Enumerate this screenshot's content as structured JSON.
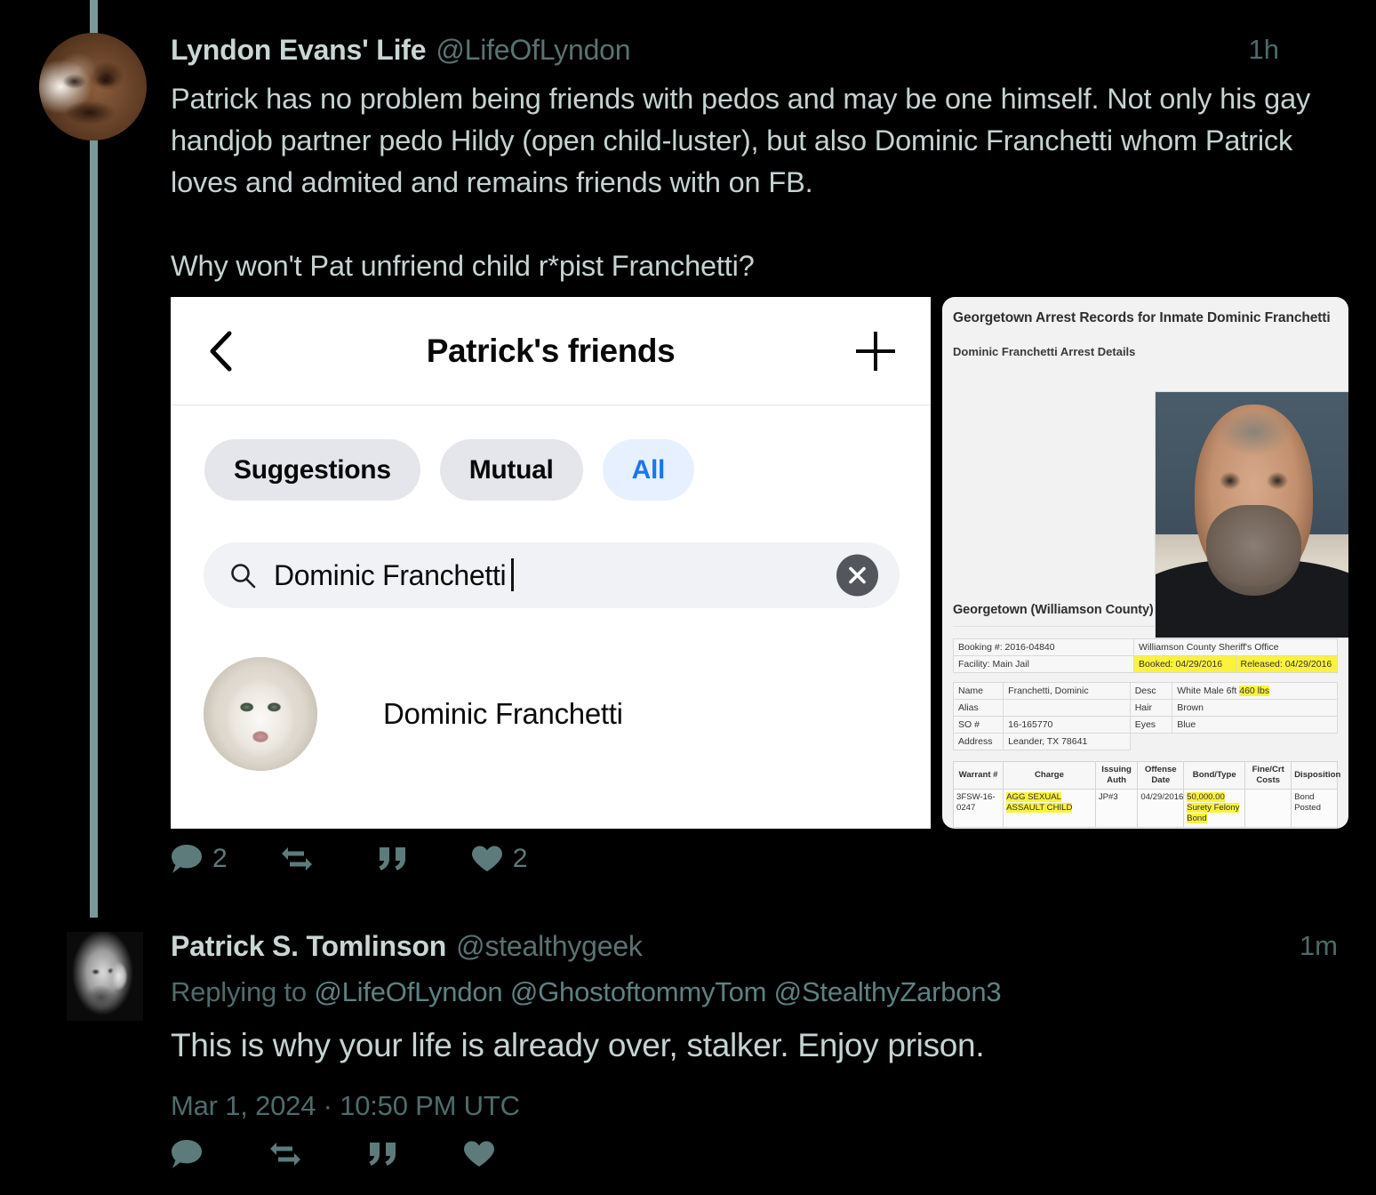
{
  "thread": {
    "tweets": [
      {
        "display_name": "Lyndon Evans' Life",
        "handle": "@LifeOfLyndon",
        "timestamp": "1h",
        "body_line1": "Patrick has no problem being friends with pedos and may be one himself. Not only his gay handjob partner pedo Hildy (open child-luster), but also Dominic Franchetti whom Patrick loves and admited and remains friends with on FB.",
        "body_line2": "Why won't Pat unfriend child r*pist Franchetti?",
        "actions": {
          "reply_count": "2",
          "retweet_count": "",
          "quote_count": "",
          "like_count": "2"
        }
      },
      {
        "display_name": "Patrick S. Tomlinson",
        "handle": "@stealthygeek",
        "timestamp": "1m",
        "replying_to_label": "Replying to",
        "replying_to_mentions": "@LifeOfLyndon @GhostoftommyTom @StealthyZarbon3",
        "body": "This is why your life is already over, stalker. Enjoy prison.",
        "date": "Mar 1, 2024 · 10:50 PM UTC",
        "actions": {
          "reply_count": "",
          "retweet_count": "",
          "quote_count": "",
          "like_count": ""
        }
      }
    ]
  },
  "facebook_card": {
    "title": "Patrick's friends",
    "back_icon": "chevron-left-icon",
    "add_icon": "plus-icon",
    "chips": [
      {
        "label": "Suggestions",
        "active": false
      },
      {
        "label": "Mutual",
        "active": false
      },
      {
        "label": "All",
        "active": true
      }
    ],
    "search": {
      "icon": "search-icon",
      "value": "Dominic Franchetti",
      "clear_icon": "close-circle-icon"
    },
    "results": [
      {
        "name": "Dominic Franchetti",
        "avatar": "white-lion-avatar"
      }
    ],
    "accent_color": "#1877f2",
    "chip_bg": "#e4e6eb",
    "chip_active_bg": "#e7f0fe"
  },
  "arrest_record": {
    "title": "Georgetown Arrest Records for Inmate Dominic Franchetti",
    "subtitle": "Dominic Franchetti Arrest Details",
    "section_title": "Georgetown (Williamson County) TX Jail Arrest Details",
    "mugshot_alt": "mugshot-photo",
    "booking_table": [
      {
        "left": "Booking #: 2016-04840",
        "right": "Williamson County Sheriff's Office",
        "right2": "",
        "hl_right": false
      },
      {
        "left": "Facility: Main Jail",
        "right": "Booked: 04/29/2016",
        "right2": "Released: 04/29/2016",
        "hl_right": true
      }
    ],
    "detail_table": [
      {
        "label": "Name",
        "value": "Franchetti, Dominic",
        "label2": "Desc",
        "value2_plain": "White  Male  6ft  ",
        "value2_hl": "460 lbs"
      },
      {
        "label": "Alias",
        "value": "",
        "label2": "Hair",
        "value2_plain": "Brown",
        "value2_hl": ""
      },
      {
        "label": "SO #",
        "value": "16-165770",
        "label2": "Eyes",
        "value2_plain": "Blue",
        "value2_hl": ""
      },
      {
        "label": "Address",
        "value": "Leander, TX 78641",
        "label2": "",
        "value2_plain": "",
        "value2_hl": ""
      }
    ],
    "charge_table": {
      "headers": [
        "Warrant #",
        "Charge",
        "Issuing Auth",
        "Offense Date",
        "Bond/Type",
        "Fine/Crt Costs",
        "Disposition"
      ],
      "rows": [
        {
          "warrant": "3FSW-16-0247",
          "charge": "AGG SEXUAL ASSAULT CHILD",
          "issuing_auth": "JP#3",
          "offense_date": "04/29/2016",
          "bond_type": "50,000.00 Surety Felony Bond",
          "fine_costs": "",
          "disposition": "Bond Posted"
        }
      ]
    },
    "highlight_color": "#fcf23c"
  },
  "icons": {
    "reply": "reply-bubble-icon",
    "retweet": "retweet-icon",
    "quote": "quote-icon",
    "like": "heart-icon"
  },
  "colors": {
    "background": "#000000",
    "text_primary": "#c5d3d1",
    "text_secondary": "#5a7272",
    "thread_line": "#7a9a9a"
  }
}
